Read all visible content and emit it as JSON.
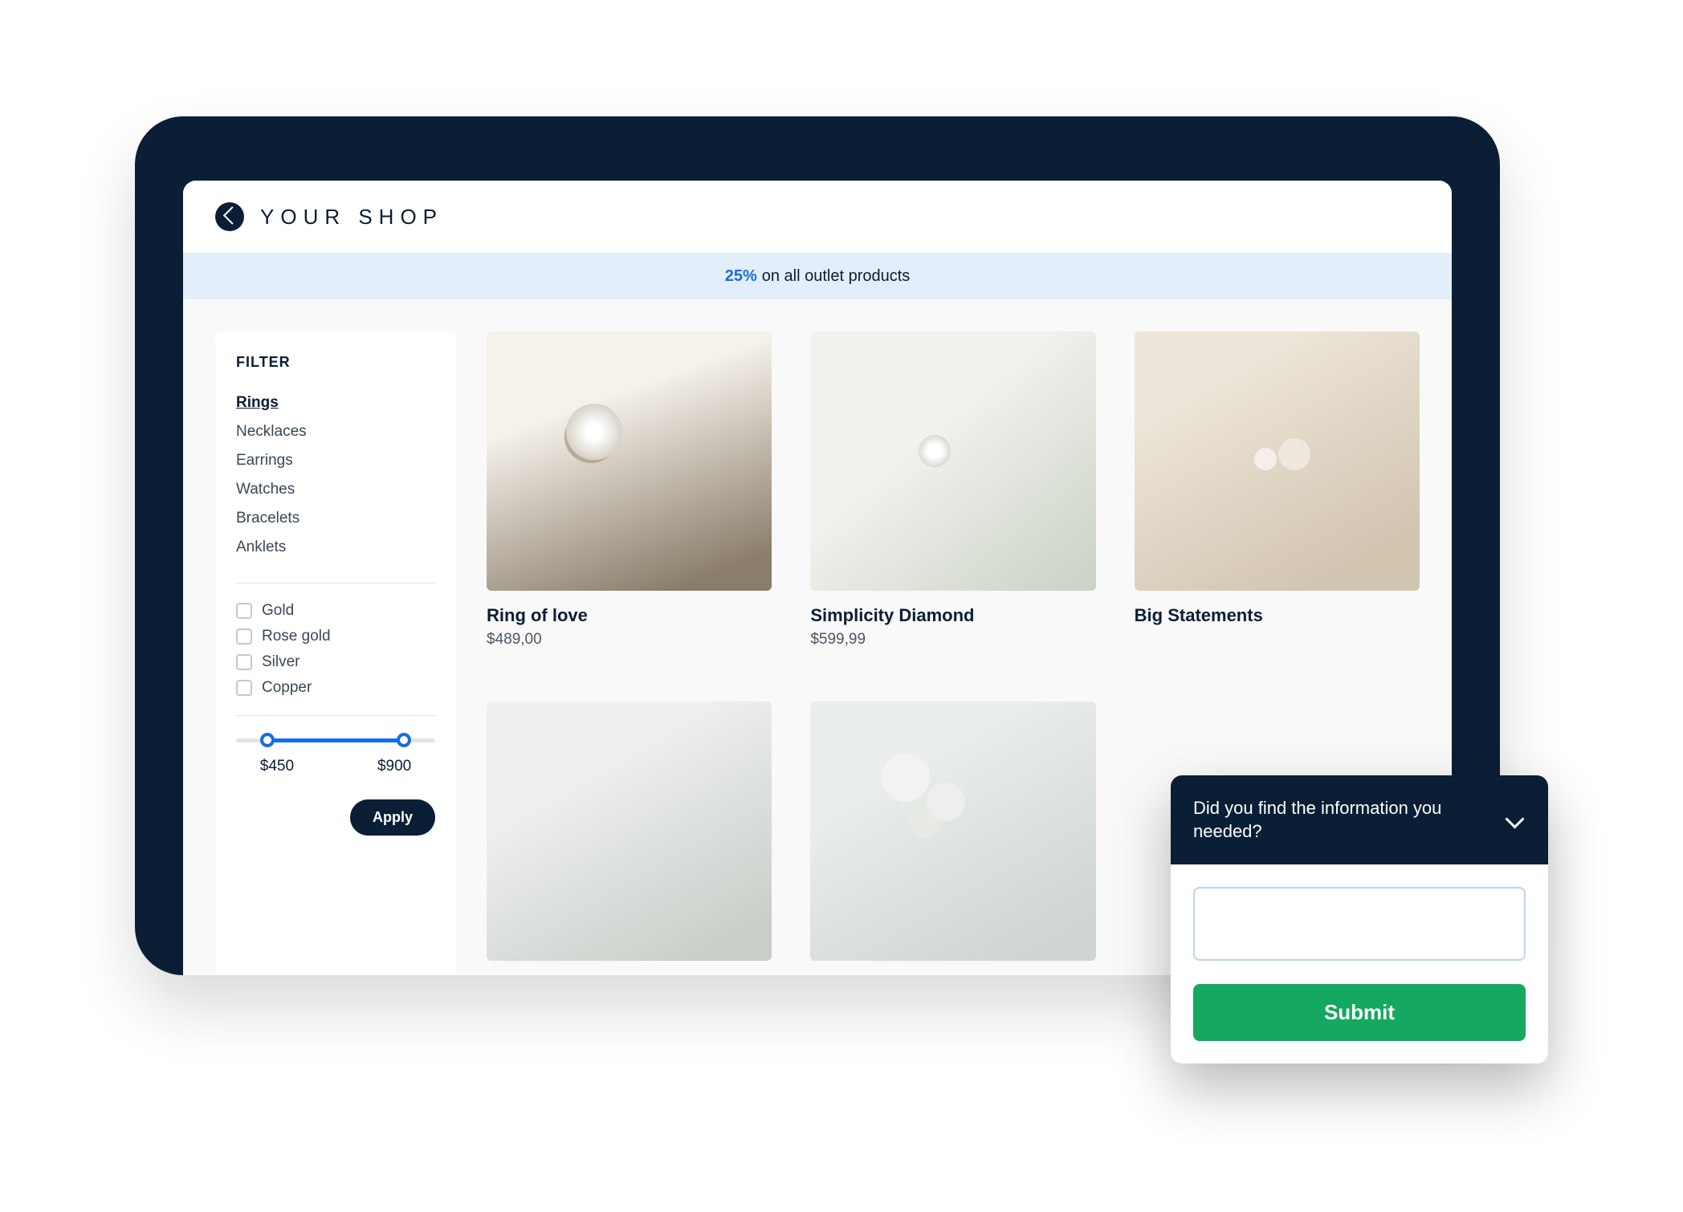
{
  "header": {
    "shop_name": "YOUR SHOP"
  },
  "promo": {
    "highlight": "25%",
    "text": " on all outlet products"
  },
  "filter": {
    "title": "FILTER",
    "categories": [
      "Rings",
      "Necklaces",
      "Earrings",
      "Watches",
      "Bracelets",
      "Anklets"
    ],
    "active_category_index": 0,
    "materials": [
      "Gold",
      "Rose gold",
      "Silver",
      "Copper"
    ],
    "price_min": "$450",
    "price_max": "$900",
    "apply_label": "Apply"
  },
  "products": [
    {
      "name": "Ring of love",
      "price": "$489,00"
    },
    {
      "name": "Simplicity Diamond",
      "price": "$599,99"
    },
    {
      "name": "Big Statements",
      "price": ""
    },
    {
      "name": "",
      "price": ""
    },
    {
      "name": "",
      "price": ""
    }
  ],
  "survey": {
    "question": "Did you find the information you needed?",
    "submit_label": "Submit"
  },
  "colors": {
    "dark": "#0a1e35",
    "accent": "#1a6de0",
    "success": "#14a860",
    "promo_bg": "#e3eefb"
  }
}
